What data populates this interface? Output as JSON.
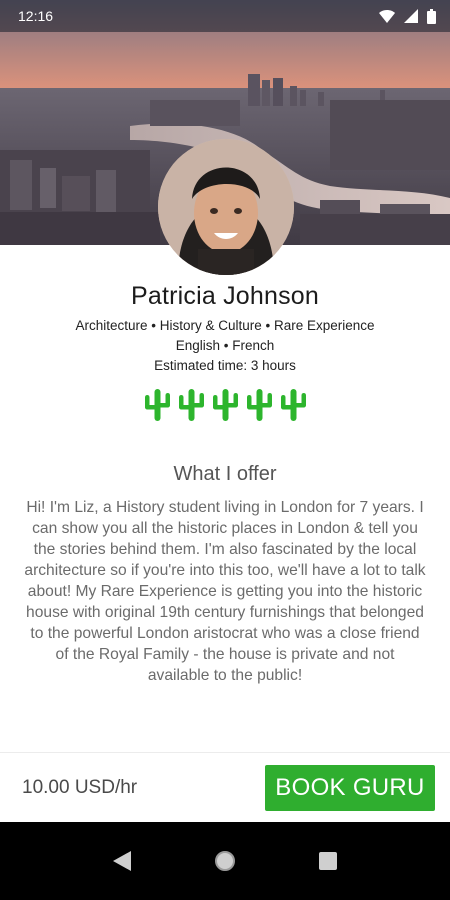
{
  "status_bar": {
    "time": "12:16",
    "icons": [
      "wifi-icon",
      "signal-icon",
      "battery-icon"
    ]
  },
  "profile": {
    "cover_image": "london-skyline-photo",
    "avatar": "guide-portrait-photo",
    "name": "Patricia Johnson",
    "categories": "Architecture • History & Culture • Rare Experience",
    "languages": "English • French",
    "estimated_time": "Estimated time: 3 hours",
    "rating": {
      "icon": "cactus-icon",
      "value": 5,
      "max": 5,
      "color": "#2db52d"
    }
  },
  "offer": {
    "title": "What I offer",
    "text": "Hi! I'm Liz, a History student living in London for 7 years. I can show you all the historic places in London & tell you the stories behind them. I'm also fascinated by the local architecture so if you're into this too, we'll have a lot to talk about! My Rare Experience is getting you into the historic house with original 19th century furnishings that belonged to the powerful London aristocrat who was a close friend of the Royal Family - the house is private and not available to the public!"
  },
  "booking": {
    "price": "10.00 USD/hr",
    "button_label": "BOOK GURU",
    "button_color": "#2fae2f"
  },
  "nav_bar": {
    "icons": [
      "back-icon",
      "home-icon",
      "recents-icon"
    ]
  }
}
